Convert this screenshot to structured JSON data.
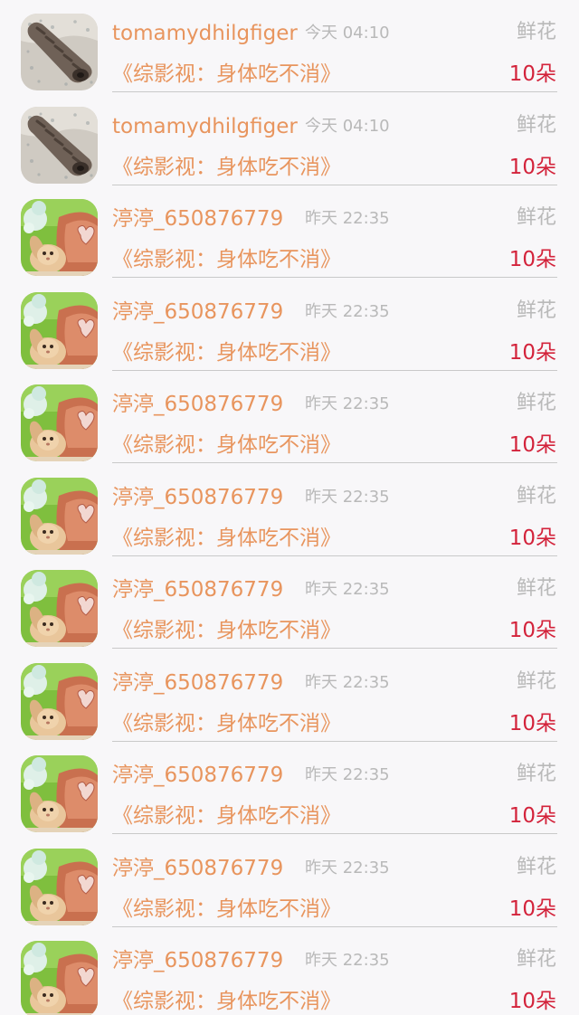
{
  "flower_list": {
    "items": [
      {
        "user": "tomamydhilgfiger",
        "time": "今天 04:10",
        "gift": "鲜花",
        "book": "《综影视：身体吃不消》",
        "count": "10朵",
        "avatar": "shell-avatar-icon"
      },
      {
        "user": "tomamydhilgfiger",
        "time": "今天 04:10",
        "gift": "鲜花",
        "book": "《综影视：身体吃不消》",
        "count": "10朵",
        "avatar": "shell-avatar-icon"
      },
      {
        "user": "渟渟_650876779",
        "time": "昨天 22:35",
        "gift": "鲜花",
        "book": "《综影视：身体吃不消》",
        "count": "10朵",
        "avatar": "bunny-avatar-icon"
      },
      {
        "user": "渟渟_650876779",
        "time": "昨天 22:35",
        "gift": "鲜花",
        "book": "《综影视：身体吃不消》",
        "count": "10朵",
        "avatar": "bunny-avatar-icon"
      },
      {
        "user": "渟渟_650876779",
        "time": "昨天 22:35",
        "gift": "鲜花",
        "book": "《综影视：身体吃不消》",
        "count": "10朵",
        "avatar": "bunny-avatar-icon"
      },
      {
        "user": "渟渟_650876779",
        "time": "昨天 22:35",
        "gift": "鲜花",
        "book": "《综影视：身体吃不消》",
        "count": "10朵",
        "avatar": "bunny-avatar-icon"
      },
      {
        "user": "渟渟_650876779",
        "time": "昨天 22:35",
        "gift": "鲜花",
        "book": "《综影视：身体吃不消》",
        "count": "10朵",
        "avatar": "bunny-avatar-icon"
      },
      {
        "user": "渟渟_650876779",
        "time": "昨天 22:35",
        "gift": "鲜花",
        "book": "《综影视：身体吃不消》",
        "count": "10朵",
        "avatar": "bunny-avatar-icon"
      },
      {
        "user": "渟渟_650876779",
        "time": "昨天 22:35",
        "gift": "鲜花",
        "book": "《综影视：身体吃不消》",
        "count": "10朵",
        "avatar": "bunny-avatar-icon"
      },
      {
        "user": "渟渟_650876779",
        "time": "昨天 22:35",
        "gift": "鲜花",
        "book": "《综影视：身体吃不消》",
        "count": "10朵",
        "avatar": "bunny-avatar-icon"
      },
      {
        "user": "渟渟_650876779",
        "time": "昨天 22:35",
        "gift": "鲜花",
        "book": "《综影视：身体吃不消》",
        "count": "10朵",
        "avatar": "bunny-avatar-icon"
      }
    ]
  },
  "colors": {
    "background": "#f8f7f9",
    "username": "#e8955e",
    "book_title": "#e8955e",
    "meta_text": "#b9b9b9",
    "count": "#d3233b",
    "divider": "#c9c9c9"
  }
}
